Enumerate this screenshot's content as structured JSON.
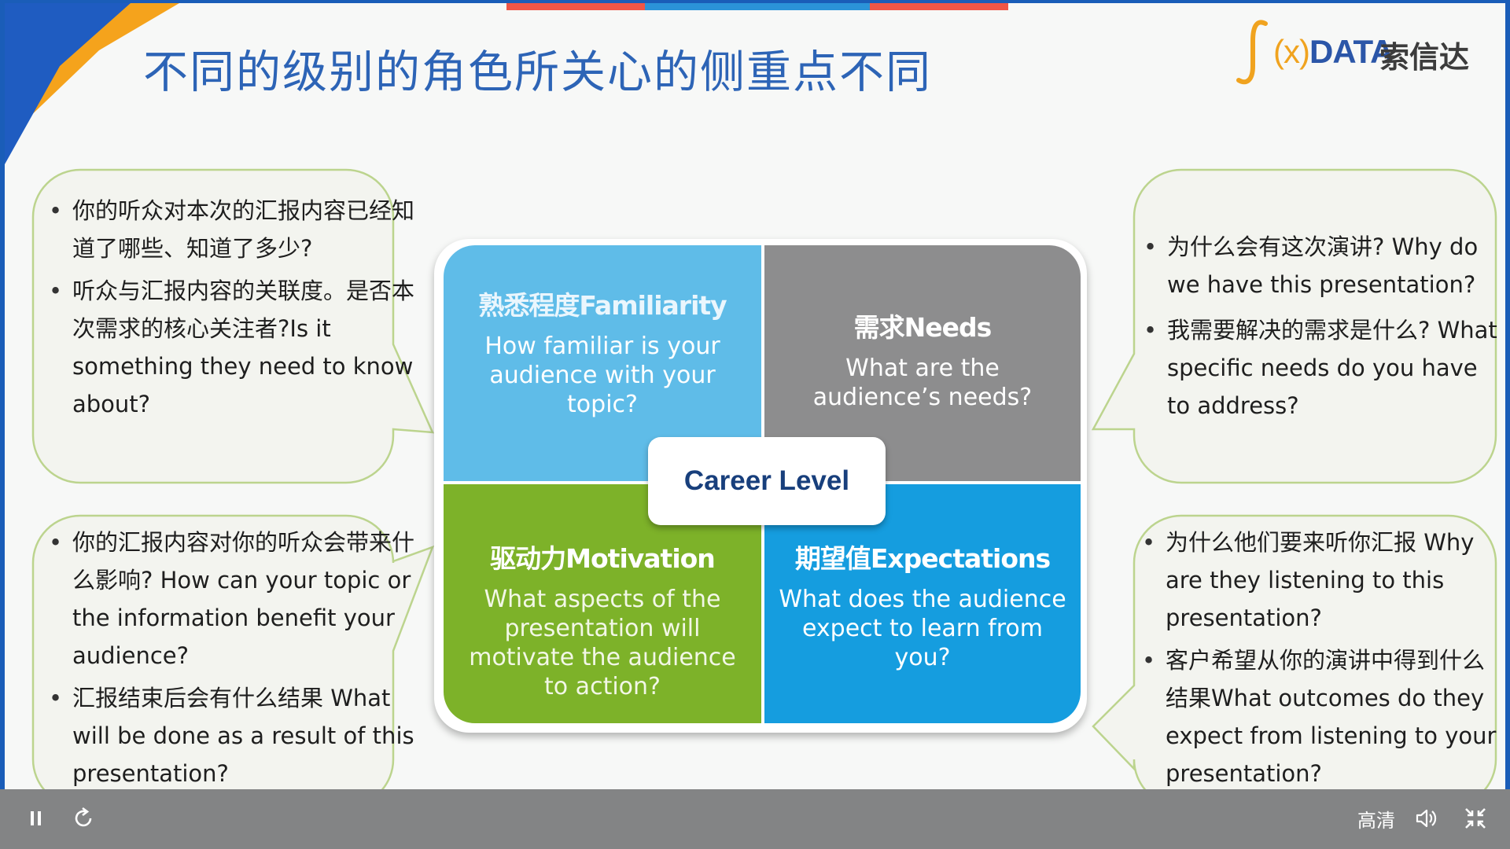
{
  "slide": {
    "title": "不同的级别的角色所关心的侧重点不同",
    "logo": {
      "integral": "∫",
      "x_mark": "(x)",
      "data_mark": "DATA",
      "company": "索信达"
    },
    "colors": {
      "blue": "#5fbce8",
      "gray": "#8d8d8e",
      "green": "#7db229",
      "deep_blue": "#159ddf",
      "title": "#2d64b6"
    }
  },
  "bubbles": {
    "top_left": [
      "你的听众对本次的汇报内容已经知道了哪些、知道了多少?",
      "听众与汇报内容的关联度。是否本次需求的核心关注者?Is it something they need to know about?"
    ],
    "bottom_left": [
      "你的汇报内容对你的听众会带来什么影响? How can your topic or the information benefit your audience?",
      "汇报结束后会有什么结果 What will be done as a result of this presentation?"
    ],
    "top_right": [
      "为什么会有这次演讲? Why do we have this presentation?",
      "我需要解决的需求是什么? What specific needs do you have to address?"
    ],
    "bottom_right": [
      "为什么他们要来听你汇报 Why are they listening to this presentation?",
      "客户希望从你的演讲中得到什么结果What outcomes do they expect from listening to your presentation?"
    ]
  },
  "quadrant": {
    "center": "Career Level",
    "familiarity": {
      "heading": "熟悉程度Familiarity",
      "body": "How familiar is your audience with your topic?"
    },
    "needs": {
      "heading": "需求Needs",
      "body": "What are the audience’s needs?"
    },
    "motivation": {
      "heading": "驱动力Motivation",
      "body": "What aspects of the presentation will motivate the audience to action?"
    },
    "expectations": {
      "heading": "期望值Expectations",
      "body": "What does the audience expect to learn from you?"
    }
  },
  "player": {
    "pause_icon": "pause-icon",
    "replay_icon": "replay-icon",
    "quality": "高清",
    "volume_icon": "volume-icon",
    "exit_fullscreen_icon": "exit-fullscreen-icon"
  }
}
